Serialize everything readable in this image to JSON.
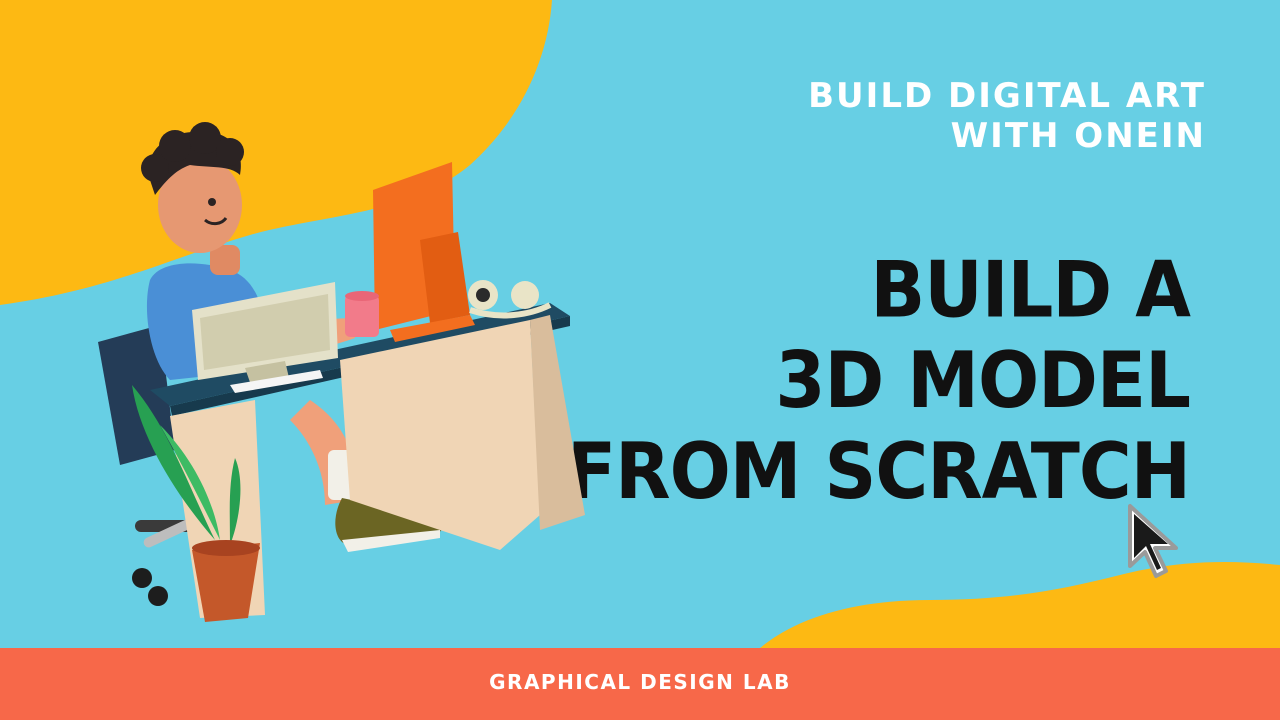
{
  "subtitle": {
    "line1": "BUILD DIGITAL ART",
    "line2": "WITH ONEIN"
  },
  "headline": {
    "line1": "BUILD A",
    "line2": "3D MODEL",
    "line3": "FROM SCRATCH"
  },
  "footer": {
    "label": "GRAPHICAL DESIGN LAB"
  },
  "colors": {
    "background": "#67cfe4",
    "accent_yellow": "#fdb913",
    "footer_band": "#f76849",
    "headline_text": "#111111",
    "subtitle_text": "#ffffff"
  },
  "icons": {
    "cursor": "arrow-cursor-icon",
    "illustration": "person-at-desk-illustration"
  }
}
